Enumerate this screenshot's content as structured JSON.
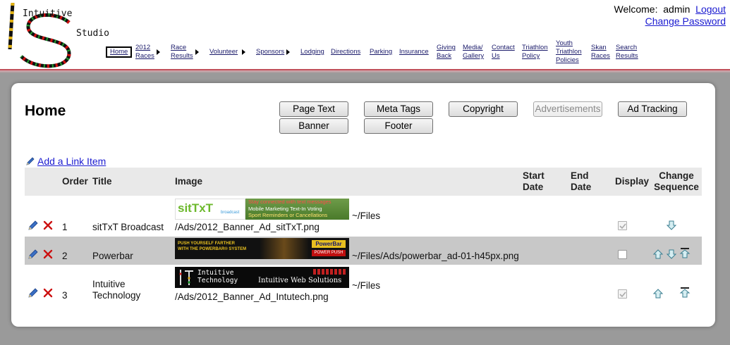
{
  "header": {
    "logo_line1": "Intuitive",
    "logo_line2": "Studio",
    "welcome_label": "Welcome:",
    "username": "admin",
    "logout": "Logout",
    "change_password": "Change Password"
  },
  "nav": {
    "home": "Home",
    "races_2012_a": "2012",
    "races_2012_b": "Races",
    "race_results_a": "Race",
    "race_results_b": "Results",
    "volunteer": "Volunteer",
    "sponsors": "Sponsors",
    "lodging": "Lodging",
    "directions": "Directions",
    "parking": "Parking",
    "insurance": "Insurance",
    "giving_a": "Giving",
    "giving_b": "Back",
    "media_a": "Media/",
    "media_b": "Gallery",
    "contact_a": "Contact",
    "contact_b": "Us",
    "tri_policy_a": "Triathlon",
    "tri_policy_b": "Policy",
    "youth_a": "Youth",
    "youth_b": "Triathlon",
    "youth_c": "Policies",
    "skan_a": "Skan",
    "skan_b": "Races",
    "search_a": "Search",
    "search_b": "Results"
  },
  "page": {
    "title": "Home",
    "add_link": "Add a Link Item"
  },
  "buttons": {
    "page_text": "Page Text",
    "meta_tags": "Meta Tags",
    "copyright": "Copyright",
    "advertisements": "Advertisements",
    "ad_tracking": "Ad Tracking",
    "banner": "Banner",
    "footer": "Footer"
  },
  "table": {
    "headers": {
      "order": "Order",
      "title": "Title",
      "image": "Image",
      "start_a": "Start",
      "start_b": "Date",
      "end_a": "End",
      "end_b": "Date",
      "display": "Display",
      "change_a": "Change",
      "change_b": "Sequence"
    },
    "rows": [
      {
        "order": "1",
        "title": "sitTxT Broadcast",
        "path_a": "~/Files",
        "path_b": "/Ads/2012_Banner_Ad_sitTxT.png",
        "display": true,
        "banner_text_1": "sitTxT",
        "banner_text_2": "broadcast",
        "banner_text_3": "Stay connected with text messages",
        "banner_text_4": "Mobile Marketing   Text-In Voting",
        "banner_text_5": "Sport Reminders or Cancellations"
      },
      {
        "order": "2",
        "title": "Powerbar",
        "path_a": "~/Files/Ads/powerbar_ad-01-h45px.png",
        "display": false,
        "banner_text_1": "PUSH YOURSELF FARTHER",
        "banner_text_2": "WITH THE POWERBAR® SYSTEM",
        "banner_text_3": "PowerBar",
        "banner_text_4": "POWER PUSH"
      },
      {
        "order": "3",
        "title_a": "Intuitive",
        "title_b": "Technology",
        "path_a": "~/Files",
        "path_b": "/Ads/2012_Banner_Ad_Intutech.png",
        "display": true,
        "banner_text_1": "Intuitive",
        "banner_text_2": "Technology",
        "banner_text_3": "Intuitive Web Solutions"
      }
    ]
  },
  "colors": {
    "link": "#1a1ad0",
    "header_rule": "#c0505a",
    "alt_row": "#c8c8c8",
    "delete_red": "#cc1111",
    "edit_blue": "#2a5db0"
  }
}
